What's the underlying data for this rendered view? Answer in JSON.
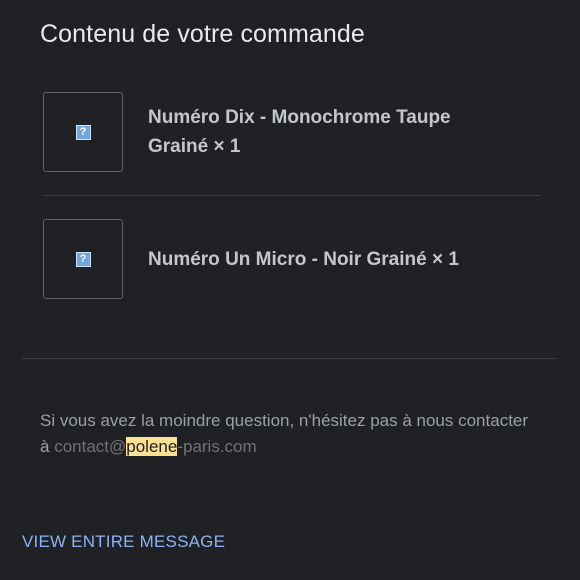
{
  "order": {
    "title": "Contenu de votre commande",
    "items": [
      {
        "name": "Numéro Dix - Monochrome Taupe Grainé × 1",
        "icon": "broken-image-icon"
      },
      {
        "name": "Numéro Un Micro - Noir Grainé × 1",
        "icon": "broken-image-icon"
      }
    ]
  },
  "help": {
    "text": "Si vous avez la moindre question, n'hésitez pas à nous contacter à ",
    "email_prefix": "contact@",
    "email_highlight": "polene",
    "email_suffix": "-paris.com"
  },
  "footer": {
    "view_message": "VIEW ENTIRE MESSAGE"
  },
  "colors": {
    "background": "#202124",
    "link": "#8ab4f8",
    "highlight": "#fde293"
  }
}
